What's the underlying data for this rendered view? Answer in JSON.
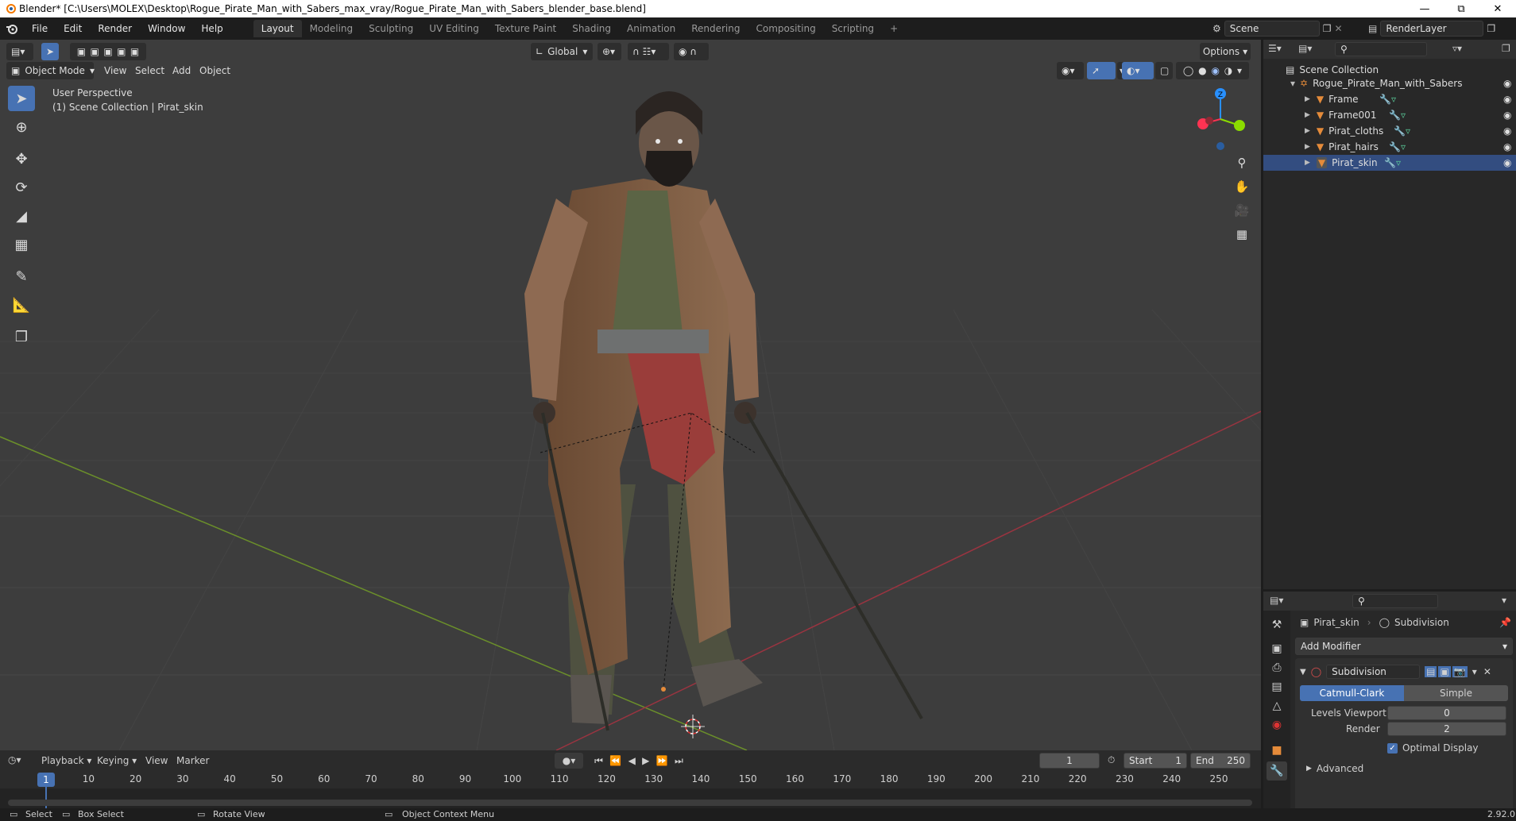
{
  "window": {
    "title": "Blender* [C:\\Users\\MOLEX\\Desktop\\Rogue_Pirate_Man_with_Sabers_max_vray/Rogue_Pirate_Man_with_Sabers_blender_base.blend]"
  },
  "menu": [
    "File",
    "Edit",
    "Render",
    "Window",
    "Help"
  ],
  "workspaces": [
    "Layout",
    "Modeling",
    "Sculpting",
    "UV Editing",
    "Texture Paint",
    "Shading",
    "Animation",
    "Rendering",
    "Compositing",
    "Scripting"
  ],
  "active_workspace": "Layout",
  "scene": {
    "name": "Scene",
    "render_layer": "RenderLayer"
  },
  "viewport": {
    "mode": "Object Mode",
    "menus": [
      "View",
      "Select",
      "Add",
      "Object"
    ],
    "transform_orientation": "Global",
    "options_label": "Options",
    "overlay_line1": "User Perspective",
    "overlay_line2": "(1) Scene Collection | Pirat_skin",
    "gizmo_labels": {
      "z": "Z",
      "x": "X",
      "y": "Y"
    }
  },
  "outliner": {
    "root": "Scene Collection",
    "collection": "Rogue_Pirate_Man_with_Sabers",
    "objects": [
      "Frame",
      "Frame001",
      "Pirat_cloths",
      "Pirat_hairs",
      "Pirat_skin"
    ],
    "selected": "Pirat_skin"
  },
  "properties": {
    "object_name": "Pirat_skin",
    "modifier_tab_label": "Subdivision",
    "add_modifier": "Add Modifier",
    "modifier": {
      "name": "Subdivision",
      "type_options": [
        "Catmull-Clark",
        "Simple"
      ],
      "type_selected": "Catmull-Clark",
      "levels_viewport_label": "Levels Viewport",
      "levels_viewport_value": "0",
      "render_label": "Render",
      "render_value": "2",
      "optimal_display_label": "Optimal Display",
      "optimal_display_checked": true,
      "advanced_label": "Advanced"
    }
  },
  "timeline": {
    "menus": [
      "Playback",
      "Keying",
      "View",
      "Marker"
    ],
    "current_frame": "1",
    "start_label": "Start",
    "start_value": "1",
    "end_label": "End",
    "end_value": "250",
    "ticks": [
      "1",
      "10",
      "20",
      "30",
      "40",
      "50",
      "60",
      "70",
      "80",
      "90",
      "100",
      "110",
      "120",
      "130",
      "140",
      "150",
      "160",
      "170",
      "180",
      "190",
      "200",
      "210",
      "220",
      "230",
      "240",
      "250"
    ]
  },
  "statusbar": {
    "select": "Select",
    "box_select": "Box Select",
    "rotate_view": "Rotate View",
    "context_menu": "Object Context Menu",
    "version": "2.92.0"
  },
  "colors": {
    "accent": "#4772b3",
    "selected_row": "#334d80",
    "viewport_bg": "#3d3d3d",
    "panel_bg": "#282828",
    "x_axis": "#ff3352",
    "y_axis": "#8bdc00",
    "z_axis": "#2890ff",
    "object_orange": "#e58b3a",
    "mesh_green": "#5bcc9a"
  }
}
